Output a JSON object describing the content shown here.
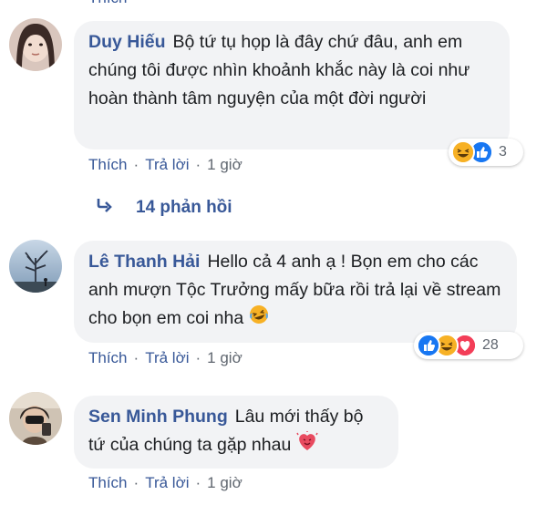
{
  "comments": [
    {
      "author": "Duy Hiếu",
      "text": "Bộ tứ tụ họp là đây chứ đâu, anh em chúng tôi được nhìn khoảnh khắc này là coi như hoàn thành tâm nguyện của một đời người",
      "actions": {
        "like": "Thích",
        "reply": "Trả lời",
        "time": "1 giờ",
        "separator": "·"
      },
      "reactions": {
        "types": [
          "haha",
          "like"
        ],
        "count": "3"
      }
    },
    {
      "author": "Lê Thanh Hải",
      "text": "Hello cả 4 anh ạ ! Bọn em cho các anh mượn Tộc Trưởng mấy bữa rồi trả lại về stream cho bọn em coi nha",
      "inline_emoji": "laughing-emoji",
      "actions": {
        "like": "Thích",
        "reply": "Trả lời",
        "time": "1 giờ",
        "separator": "·"
      },
      "reactions": {
        "types": [
          "like",
          "haha",
          "love"
        ],
        "count": "28"
      }
    },
    {
      "author": "Sen Minh Phung",
      "text": "Lâu mới thấy bộ tứ của chúng ta gặp nhau",
      "inline_emoji": "heart-eyes-emoji",
      "actions": {
        "like": "Thích",
        "reply": "Trả lời",
        "time": "1 giờ",
        "separator": "·"
      }
    }
  ],
  "replies_link": {
    "label": "14 phản hồi",
    "icon": "reply-arrow-icon"
  },
  "colors": {
    "author": "#385898",
    "bubble": "#f2f3f5",
    "meta": "#606770",
    "like": "#1877f2",
    "haha": "#f7b125",
    "love": "#f33e58"
  }
}
